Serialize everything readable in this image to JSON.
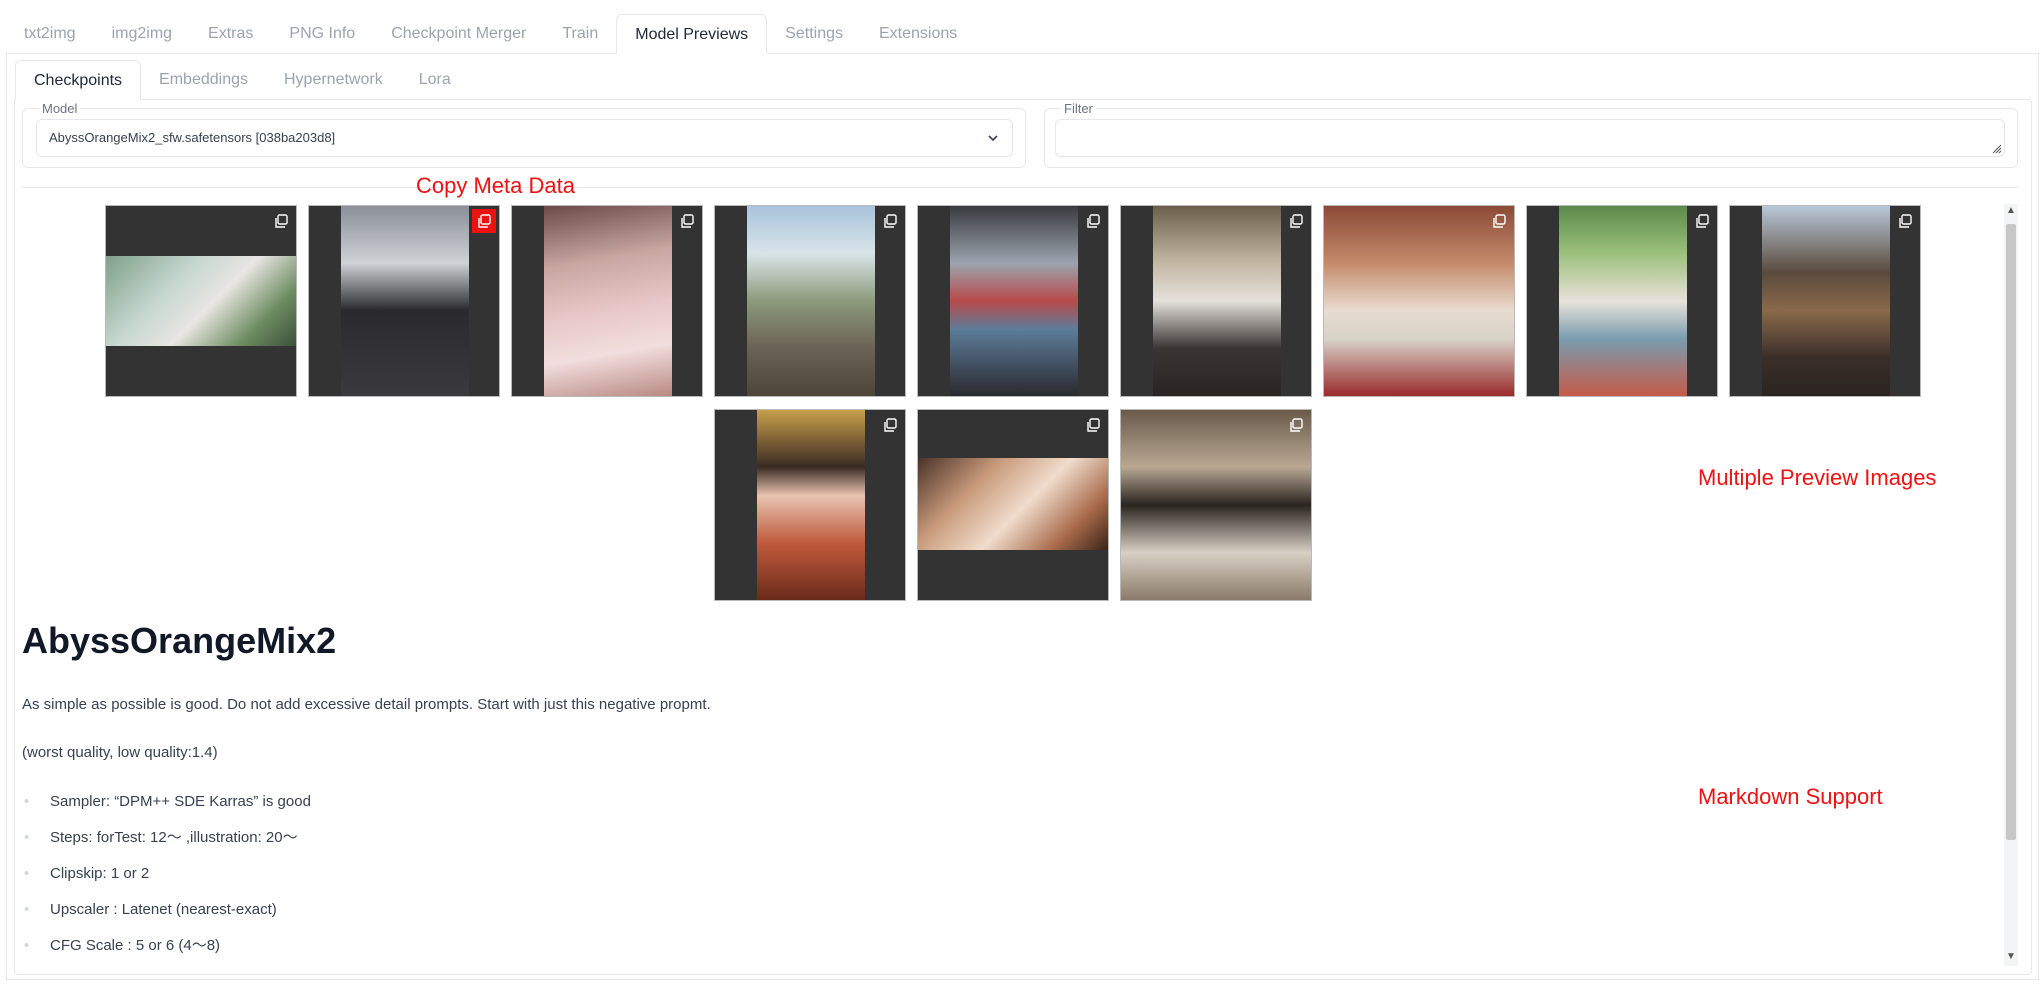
{
  "top_tabs": [
    "txt2img",
    "img2img",
    "Extras",
    "PNG Info",
    "Checkpoint Merger",
    "Train",
    "Model Previews",
    "Settings",
    "Extensions"
  ],
  "sub_tabs": [
    "Checkpoints",
    "Embeddings",
    "Hypernetwork",
    "Lora"
  ],
  "model": {
    "label": "Model",
    "value": "AbyssOrangeMix2_sfw.safetensors [038ba203d8]"
  },
  "filter": {
    "label": "Filter",
    "value": ""
  },
  "annotations": {
    "copy_meta": "Copy Meta Data",
    "multiple_previews": "Multiple Preview Images",
    "markdown_support": "Markdown Support"
  },
  "markdown": {
    "title": "AbyssOrangeMix2",
    "intro": "As simple as possible is good. Do not add excessive detail prompts. Start with just this negative propmt.",
    "negative": "(worst quality, low quality:1.4)",
    "list": [
      "Sampler: “DPM++ SDE Karras” is good",
      "Steps: forTest: 12〜 ,illustration: 20〜",
      "Clipskip: 1 or 2",
      "Upscaler : Latenet (nearest-exact)",
      "CFG Scale : 5 or 6 (4〜8)"
    ]
  },
  "colors": {
    "annotation": "#ee1111",
    "thumb_bg": "#333333"
  }
}
